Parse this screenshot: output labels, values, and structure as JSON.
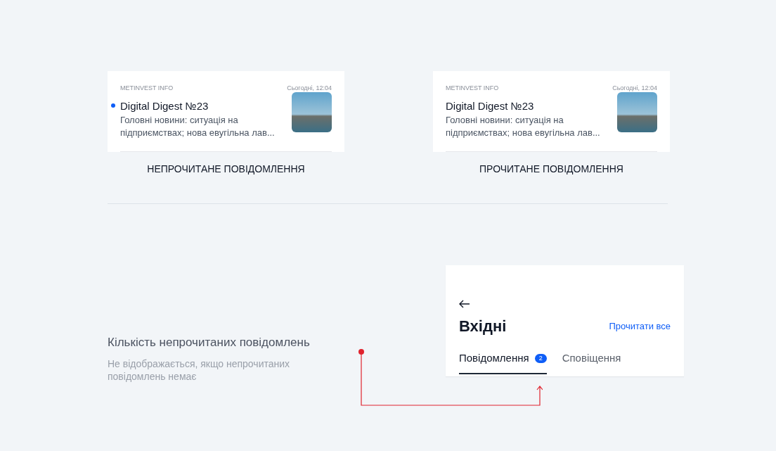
{
  "previews": [
    {
      "unread": true,
      "source": "METINVEST INFO",
      "time": "Сьогодні, 12:04",
      "title": "Digital Digest №23",
      "body": "Головні новини: ситуація на підприємствах; нова евугільна лав...",
      "caption": "НЕПРОЧИТАНЕ ПОВІДОМЛЕННЯ"
    },
    {
      "unread": false,
      "source": "METINVEST INFO",
      "time": "Сьогодні, 12:04",
      "title": "Digital Digest №23",
      "body": "Головні новини: ситуація на підприємствах; нова евугільна лав...",
      "caption": "ПРОЧИТАНЕ ПОВІДОМЛЕННЯ"
    }
  ],
  "note": {
    "title": "Кількість непрочитаних повідомлень",
    "subtitle": "Не відображається, якщо непрочитаних повідомлень немає"
  },
  "inbox": {
    "title": "Вхідні",
    "action": "Прочитати все",
    "tabs": [
      {
        "label": "Повідомлення",
        "selected": true,
        "badge": "2"
      },
      {
        "label": "Сповіщення",
        "selected": false
      }
    ]
  }
}
